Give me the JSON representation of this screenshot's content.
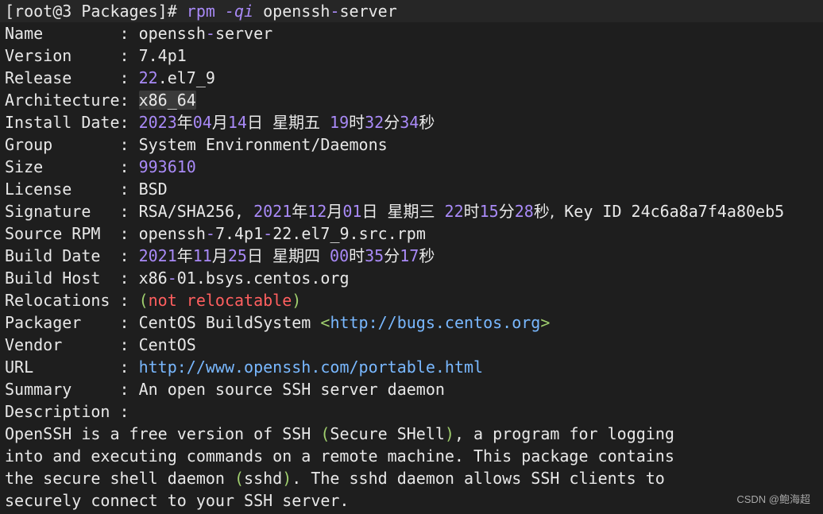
{
  "command_line": {
    "prompt": "[root@3 Packages]#",
    "cmd": "rpm",
    "flag": "-qi",
    "arg_a": "openssh",
    "arg_dash": "-",
    "arg_b": "server"
  },
  "fields": {
    "name": {
      "label": "Name        :",
      "v1": "openssh",
      "v2": "-",
      "v3": "server"
    },
    "version": {
      "label": "Version     :",
      "v1": "7.4p1"
    },
    "release": {
      "label": "Release     :",
      "v1": "22",
      "v2": ".el7_9"
    },
    "arch": {
      "label": "Architecture:",
      "v1": "x86_64"
    },
    "install_date": {
      "label": "Install Date:",
      "year": "2023",
      "u_year": "年",
      "month": "04",
      "u_month": "月",
      "day": "14",
      "u_day": "日",
      "weekday": "星期五",
      "hour": "19",
      "u_hour": "时",
      "min": "32",
      "u_min": "分",
      "sec": "34",
      "u_sec": "秒"
    },
    "group": {
      "label": "Group       :",
      "v1": "System Environment/Daemons"
    },
    "size": {
      "label": "Size        :",
      "v1": "993610"
    },
    "license": {
      "label": "License     :",
      "v1": "BSD"
    },
    "signature": {
      "label": "Signature   :",
      "prefix": "RSA/SHA256,",
      "year": "2021",
      "u_year": "年",
      "month": "12",
      "u_month": "月",
      "day": "01",
      "u_day": "日",
      "weekday": "星期三",
      "hour": "22",
      "u_hour": "时",
      "min": "15",
      "u_min": "分",
      "sec": "28",
      "u_sec": "秒,",
      "key": "Key ID 24c6a8a7f4a80eb5"
    },
    "source_rpm": {
      "label": "Source RPM  :",
      "v1": "openssh",
      "v2": "-",
      "v3": "7.4p1",
      "v4": "-",
      "v5": "22.el7_9.src.rpm"
    },
    "build_date": {
      "label": "Build Date  :",
      "year": "2021",
      "u_year": "年",
      "month": "11",
      "u_month": "月",
      "day": "25",
      "u_day": "日",
      "weekday": "星期四",
      "hour": "00",
      "u_hour": "时",
      "min": "35",
      "u_min": "分",
      "sec": "17",
      "u_sec": "秒"
    },
    "build_host": {
      "label": "Build Host  :",
      "v1": "x86",
      "v2": "-",
      "v3": "01.bsys.centos.org"
    },
    "relocations": {
      "label": "Relocations :",
      "open": "(",
      "text": "not relocatable",
      "close": ")"
    },
    "packager": {
      "label": "Packager    :",
      "v1": "CentOS BuildSystem",
      "lt": "<",
      "url": "http://bugs.centos.org",
      "gt": ">"
    },
    "vendor": {
      "label": "Vendor      :",
      "v1": "CentOS"
    },
    "url": {
      "label": "URL         :",
      "v1": "http://www.openssh.com/portable.html"
    },
    "summary": {
      "label": "Summary     :",
      "v1": "An open source SSH server daemon"
    },
    "description": {
      "label": "Description :"
    }
  },
  "description_lines": {
    "l1": {
      "a": "OpenSSH is a free version of SSH ",
      "b": "(",
      "c": "Secure SHell",
      "d": ")",
      "e": ", a program for logging"
    },
    "l2": {
      "a": "into and executing commands on a remote machine. This package contains"
    },
    "l3": {
      "a": "the secure shell daemon ",
      "b": "(",
      "c": "sshd",
      "d": ")",
      "e": ". The sshd daemon allows SSH clients to"
    },
    "l4": {
      "a": "securely connect to your SSH server."
    }
  },
  "watermark": "CSDN @鲍海超",
  "colors": {
    "background": "#1e1e1e",
    "text": "#e8e8e8",
    "number": "#a98af7",
    "prompt_hash": "#f47aa8",
    "url": "#79b8ff",
    "dash": "#a0cf6e",
    "error": "#ff5f5f"
  }
}
